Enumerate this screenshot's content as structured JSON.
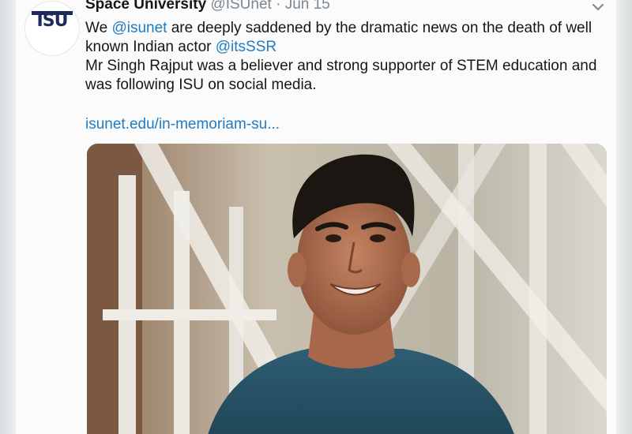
{
  "tweet": {
    "display_name": "Space University",
    "handle": "@ISUnet",
    "separator": "·",
    "date": "Jun 15",
    "line1_prefix": "We ",
    "mention1": "@isunet",
    "line1_rest": " are deeply saddened by the dramatic news on the death of well known Indian actor ",
    "mention2": "@itsSSR",
    "line2": "Mr Singh Rajput was a believer and strong supporter of STEM education and was following ISU on social media.",
    "link": "isunet.edu/in-memoriam-su..."
  },
  "avatar": {
    "logo_text": "ISU"
  },
  "icons": {
    "menu": "chevron-down-icon"
  },
  "colors": {
    "link": "#1f7bc2",
    "muted": "#7b8791",
    "text": "#14171a"
  }
}
